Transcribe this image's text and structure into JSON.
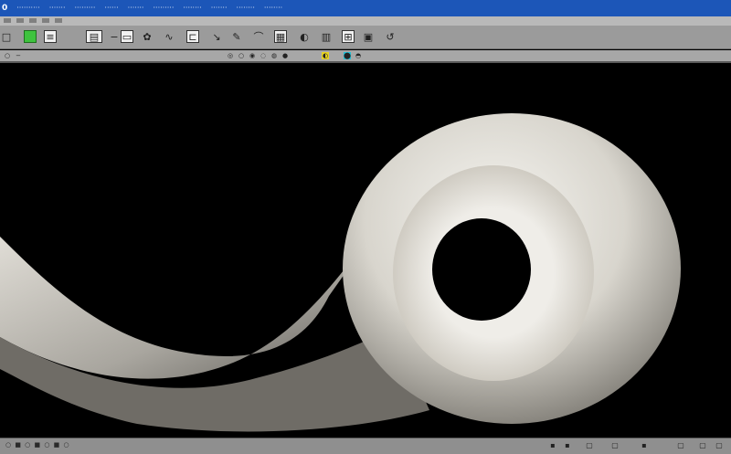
{
  "menu": {
    "logo": "0",
    "items": [
      "··········",
      "·······",
      "·········",
      "······",
      "·······",
      "·········",
      "········",
      "·······",
      "········",
      "········"
    ]
  },
  "toolbar": {
    "tools": [
      "new-file-icon",
      "layer-icon",
      "grid-icon",
      "table-icon",
      "minus-icon",
      "selection-icon",
      "paint-icon",
      "curve-icon",
      "frame-icon",
      "line-icon",
      "pen-icon",
      "move-icon",
      "text-icon",
      "sphere-icon",
      "chart-icon",
      "grid-layout-icon",
      "rotate-icon"
    ]
  },
  "statusline": {
    "items": [
      "◎",
      "○",
      "◉",
      "◌",
      "◍",
      "●",
      "◐",
      "⬤",
      "◓"
    ]
  },
  "colors": {
    "menubar": "#1c56b8",
    "toolbar": "#9b9b9b",
    "model": "#d9d6ce",
    "highlight_yellow": "#e7d223",
    "highlight_cyan": "#22c1d6"
  },
  "footer": {
    "left_text": "○ ■ ○ ■ ○ ■ ○"
  }
}
